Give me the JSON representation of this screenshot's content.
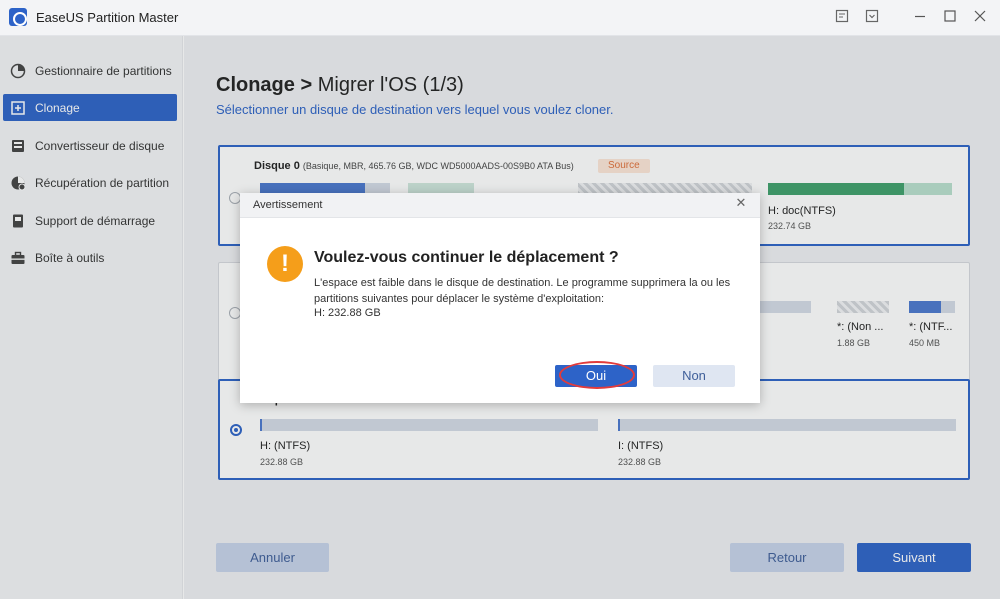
{
  "app": {
    "title": "EaseUS Partition Master"
  },
  "titlebar_icons": [
    "feedback-icon",
    "menu-icon",
    "minimize-icon",
    "maximize-icon",
    "close-icon"
  ],
  "sidebar": {
    "items": [
      {
        "label": "Gestionnaire de partitions",
        "icon": "pie-chart-icon",
        "active": false
      },
      {
        "label": "Clonage",
        "icon": "clone-icon",
        "active": true
      },
      {
        "label": "Convertisseur de disque",
        "icon": "disk-convert-icon",
        "active": false
      },
      {
        "label": "Récupération de partition",
        "icon": "partition-recovery-icon",
        "active": false
      },
      {
        "label": "Support de démarrage",
        "icon": "boot-media-icon",
        "active": false
      },
      {
        "label": "Boîte à outils",
        "icon": "toolbox-icon",
        "active": false
      }
    ]
  },
  "page": {
    "title_main": "Clonage",
    "title_sep": ">",
    "title_step": "Migrer l'OS (1/3)",
    "subtitle": "Sélectionner un disque de destination vers lequel vous voulez cloner."
  },
  "disks": {
    "disk0": {
      "name": "Disque 0",
      "details": "(Basique, MBR, 465.76 GB, WDC WD5000AADS-00S9B0 ATA Bus)",
      "badge": "Source",
      "partition_label": "doc(NTFS)",
      "partition_size": "232.74 GB"
    },
    "disk1": {
      "partitions": [
        {
          "label": "*: (Non ...",
          "size": "1.88 GB"
        },
        {
          "label": "*: (NTF...",
          "size": "450 MB"
        }
      ]
    },
    "disk2": {
      "name": "Disque 2",
      "partitions": [
        {
          "label": "H: (NTFS)",
          "size": "232.88 GB"
        },
        {
          "label": "I: (NTFS)",
          "size": "232.88 GB"
        }
      ]
    }
  },
  "buttons": {
    "cancel": "Annuler",
    "back": "Retour",
    "next": "Suivant"
  },
  "colors": {
    "accent": "#2d63c8",
    "warning": "#f59e1a",
    "highlight_ring": "#e23b3b",
    "source_badge": "#e0703a"
  },
  "dialog": {
    "title": "Avertissement",
    "icon": "warning-icon",
    "heading": "Voulez-vous continuer le déplacement ?",
    "message": "L'espace est faible dans le disque de destination. Le programme supprimera la ou les partitions suivantes pour déplacer le système d'exploitation:",
    "detail": "H: 232.88 GB",
    "yes": "Oui",
    "no": "Non"
  }
}
